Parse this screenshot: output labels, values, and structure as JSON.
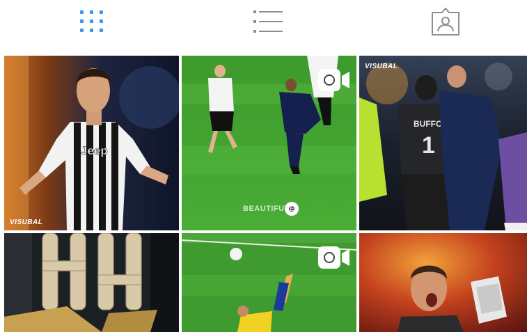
{
  "tabs": [
    {
      "name": "grid",
      "icon": "grid-icon",
      "active": true
    },
    {
      "name": "list",
      "icon": "list-icon",
      "active": false
    },
    {
      "name": "tagged",
      "icon": "tagged-icon",
      "active": false
    }
  ],
  "colors": {
    "active_tab": "#3897f0",
    "inactive_tab": "#8e8e8e",
    "background": "#ffffff"
  },
  "posts": [
    {
      "id": "post-1",
      "type": "photo",
      "watermark": "VISUBAL",
      "jersey_text": "Jeep"
    },
    {
      "id": "post-2",
      "type": "video",
      "video_icon": "video-camera-icon",
      "watermark": "BEAUTIFUTE"
    },
    {
      "id": "post-3",
      "type": "photo",
      "watermark": "VISUBAL",
      "jersey_name": "BUFFON",
      "jersey_number": "1"
    },
    {
      "id": "post-4",
      "type": "photo"
    },
    {
      "id": "post-5",
      "type": "video",
      "video_icon": "video-camera-icon"
    },
    {
      "id": "post-6",
      "type": "photo"
    }
  ]
}
